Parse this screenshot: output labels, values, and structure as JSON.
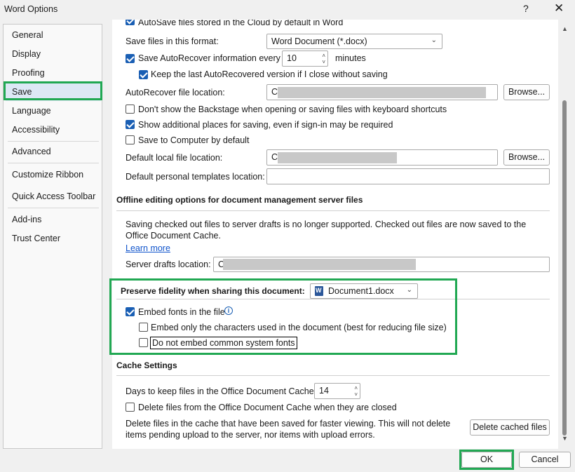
{
  "window": {
    "title": "Word Options",
    "help_label": "?",
    "close_label": "✕"
  },
  "sidebar": {
    "items": [
      {
        "label": "General"
      },
      {
        "label": "Display"
      },
      {
        "label": "Proofing"
      },
      {
        "label": "Save"
      },
      {
        "label": "Language"
      },
      {
        "label": "Accessibility"
      },
      {
        "label": "Advanced"
      },
      {
        "label": "Customize Ribbon"
      },
      {
        "label": "Quick Access Toolbar"
      },
      {
        "label": "Add-ins"
      },
      {
        "label": "Trust Center"
      }
    ],
    "selected": "Save"
  },
  "save": {
    "autosave_label": "AutoSave files stored in the Cloud by default in Word",
    "format_label": "Save files in this format:",
    "format_value": "Word Document (*.docx)",
    "autorecover_label": "Save AutoRecover information every",
    "autorecover_value": "10",
    "minutes_label": "minutes",
    "keep_last_label": "Keep the last AutoRecovered version if I close without saving",
    "autorecover_location_label": "AutoRecover file location:",
    "autorecover_location_value": "C:\\",
    "browse_label": "Browse...",
    "backstage_label": "Don't show the Backstage when opening or saving files with keyboard shortcuts",
    "additional_places_label": "Show additional places for saving, even if sign-in may be required",
    "save_to_computer_label": "Save to Computer by default",
    "default_local_label": "Default local file location:",
    "default_local_value": "C:\\",
    "default_templates_label": "Default personal templates location:"
  },
  "offline": {
    "title": "Offline editing options for document management server files",
    "notice": "Saving checked out files to server drafts is no longer supported. Checked out files are now saved to the Office Document Cache.",
    "learn_more": "Learn more",
    "server_drafts_label": "Server drafts location:",
    "server_drafts_value": "C"
  },
  "fidelity": {
    "title": "Preserve fidelity when sharing this document:",
    "document": "Document1.docx",
    "embed_fonts_label": "Embed fonts in the file",
    "embed_only_label": "Embed only the characters used in the document (best for reducing file size)",
    "no_common_label": "Do not embed common system fonts"
  },
  "cache": {
    "title": "Cache Settings",
    "days_label": "Days to keep files in the Office Document Cache:",
    "days_value": "14",
    "delete_closed_label": "Delete files from the Office Document Cache when they are closed",
    "delete_info": "Delete files in the cache that have been saved for faster viewing. This will not delete items pending upload to the server, nor items with upload errors.",
    "delete_button": "Delete cached files"
  },
  "footer": {
    "ok_label": "OK",
    "cancel_label": "Cancel"
  },
  "colors": {
    "highlight": "#21a853",
    "accent": "#1a5fb4"
  }
}
